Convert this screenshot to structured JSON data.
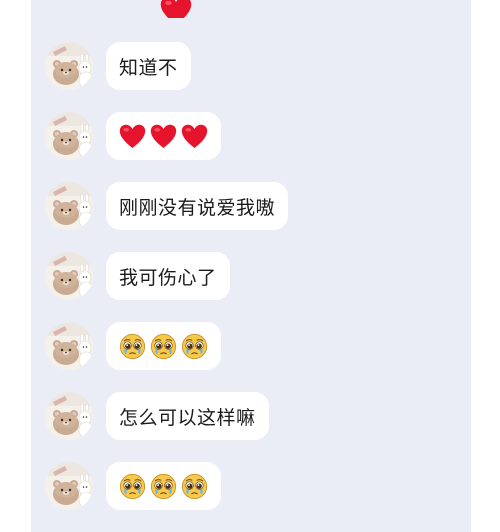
{
  "messages": [
    {
      "type": "text",
      "text": "知道不"
    },
    {
      "type": "emoji",
      "emoji": "red-heart",
      "count": 3
    },
    {
      "type": "text",
      "text": "刚刚没有说爱我嗷"
    },
    {
      "type": "text",
      "text": "我可伤心了"
    },
    {
      "type": "emoji",
      "emoji": "pleading-face",
      "count": 3
    },
    {
      "type": "text",
      "text": "怎么可以这样嘛"
    },
    {
      "type": "emoji",
      "emoji": "pleading-face",
      "count": 3
    }
  ],
  "colors": {
    "chat_background": "#ebedf6",
    "bubble": "#ffffff",
    "heart": "#e5142c",
    "emoji_face": "#f7c94a"
  }
}
